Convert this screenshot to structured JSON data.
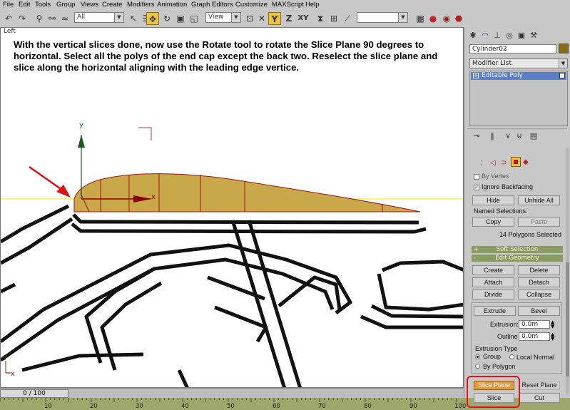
{
  "menu": [
    "File",
    "Edit",
    "Tools",
    "Group",
    "Views",
    "Create",
    "Modifiers",
    "Animation",
    "Graph Editors",
    "Customize",
    "MAXScript",
    "Help"
  ],
  "toolbar": {
    "selection_filter": "All",
    "reference_coord": "View",
    "axis_constraints": [
      "Y",
      "Z",
      "XY"
    ]
  },
  "viewport": {
    "label": "Left",
    "instructions": "With the vertical slices done, now use the Rotate tool to rotate the Slice Plane 90 degrees to horizontal.  Select all the polys of the end cap except the back two. Reselect the slice plane and slice along the horizontal aligning with the leading edge vertice.",
    "gizmo_axes": {
      "y": "y",
      "x": "x"
    },
    "corner_axes": {
      "y": "y",
      "x": "x"
    },
    "colors": {
      "selection": "#c8a848",
      "edge": "#9c1414",
      "slice_plane": "#f2e800",
      "arrow": "#e01010",
      "gizmo_y": "#1c5a1c",
      "gizmo_x": "#8a0000"
    }
  },
  "timeline": {
    "frame": "0 / 100",
    "ticks": [
      "10",
      "20",
      "30",
      "40",
      "50",
      "60",
      "70",
      "80",
      "90",
      "100"
    ]
  },
  "panel": {
    "object_name": "Cylinder02",
    "object_color": "#8a6a12",
    "modifier_list": "Modifier List",
    "stack_item": "Editable Poly",
    "selection": {
      "by_vertex": "By Vertex",
      "ignore_backfacing": "Ignore Backfacing",
      "hide": "Hide",
      "unhide_all": "Unhide All",
      "named_selections": "Named Selections:",
      "copy": "Copy",
      "paste": "Paste",
      "status": "14 Polygons Selected"
    },
    "rollouts": {
      "soft_selection": "Soft Selection",
      "edit_geometry": "Edit Geometry"
    },
    "geometry": {
      "create": "Create",
      "delete": "Delete",
      "attach": "Attach",
      "detach": "Detach",
      "divide": "Divide",
      "collapse": "Collapse",
      "extrude": "Extrude",
      "bevel": "Bevel",
      "extrusion_label": "Extrusion:",
      "extrusion_value": "0.0m",
      "outline_label": "Outline",
      "outline_value": "0.0m",
      "extrusion_type": "Extrusion Type",
      "group": "Group",
      "local_normal": "Local Normal",
      "by_polygon": "By Polygon",
      "slice_plane": "Slice Plane",
      "reset_plane": "Reset Plane",
      "slice": "Slice",
      "cut": "Cut"
    }
  }
}
